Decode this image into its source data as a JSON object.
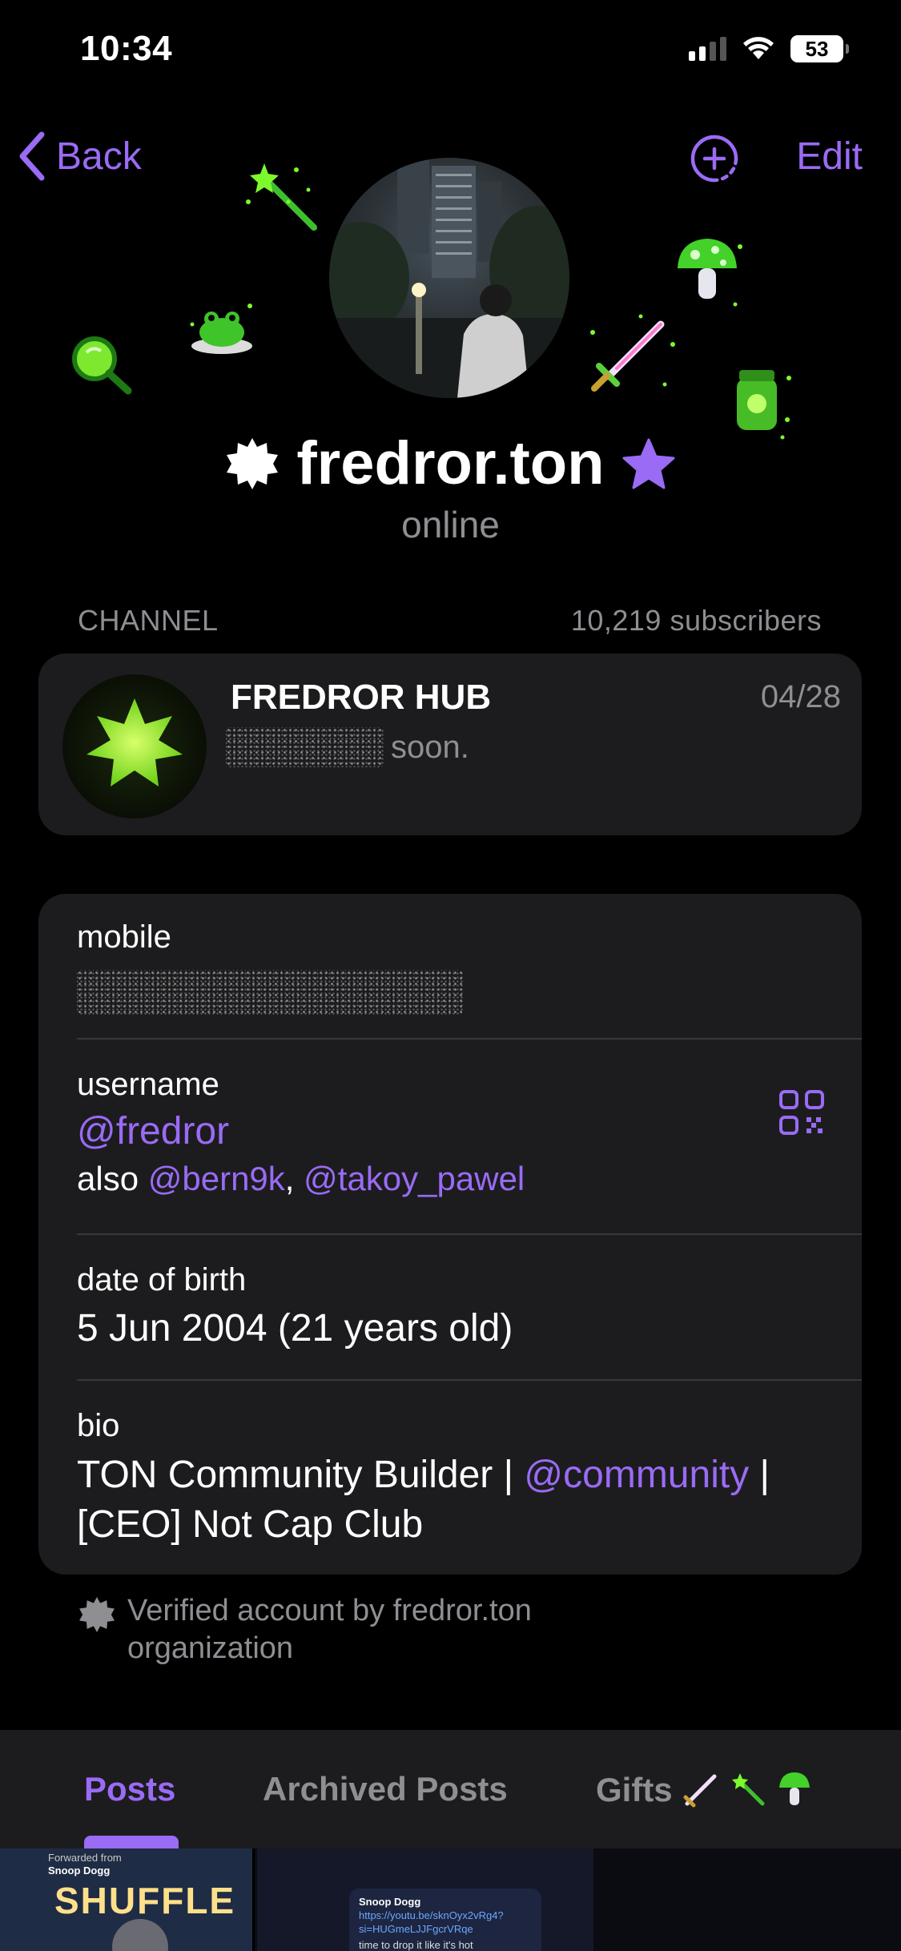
{
  "status_bar": {
    "time": "10:34",
    "battery": "53"
  },
  "nav": {
    "back_label": "Back",
    "edit_label": "Edit"
  },
  "profile": {
    "name": "fredror.ton",
    "status": "online"
  },
  "channel": {
    "section_label": "CHANNEL",
    "subscribers": "10,219 subscribers",
    "name": "FREDROR HUB",
    "date": "04/28",
    "preview_text": "soon."
  },
  "info": {
    "mobile_label": "mobile",
    "username_label": "username",
    "username": "@fredror",
    "also_prefix": "also",
    "also_user1": "@bern9k",
    "also_sep": ",",
    "also_user2": "@takoy_pawel",
    "dob_label": "date of birth",
    "dob_value": "5 Jun 2004 (21 years old)",
    "bio_label": "bio",
    "bio_part1": "TON Community Builder |",
    "bio_link": "@community",
    "bio_part2": "| [CEO] Not Cap Club"
  },
  "verified_note": {
    "line1": "Verified account by fredror.ton",
    "line2": "organization"
  },
  "tabs": [
    {
      "label": "Posts",
      "active": true
    },
    {
      "label": "Archived Posts",
      "active": false
    },
    {
      "label": "Gifts",
      "active": false
    }
  ],
  "posts_preview": {
    "post1_forward": "Forwarded from",
    "post1_source": "Snoop Dogg",
    "post1_title": "SHUFFLE",
    "post2_author": "Snoop Dogg",
    "post2_link1": "https://youtu.be/sknOyx2vRg4?",
    "post2_link2": "si=HUGmeLJJFgcrVRqe",
    "post2_text": "time to drop it like it's hot"
  },
  "colors": {
    "accent": "#9a6bf5",
    "card": "#1c1c1e",
    "secondary_text": "#8e8e93",
    "gift_green": "#7df92e"
  },
  "icons": [
    "chevron-left-icon",
    "add-status-icon",
    "verified-badge-icon",
    "premium-star-icon",
    "qr-code-icon",
    "wand-icon",
    "mushroom-icon",
    "sword-icon",
    "frog-icon",
    "magnifier-icon",
    "jar-icon"
  ]
}
